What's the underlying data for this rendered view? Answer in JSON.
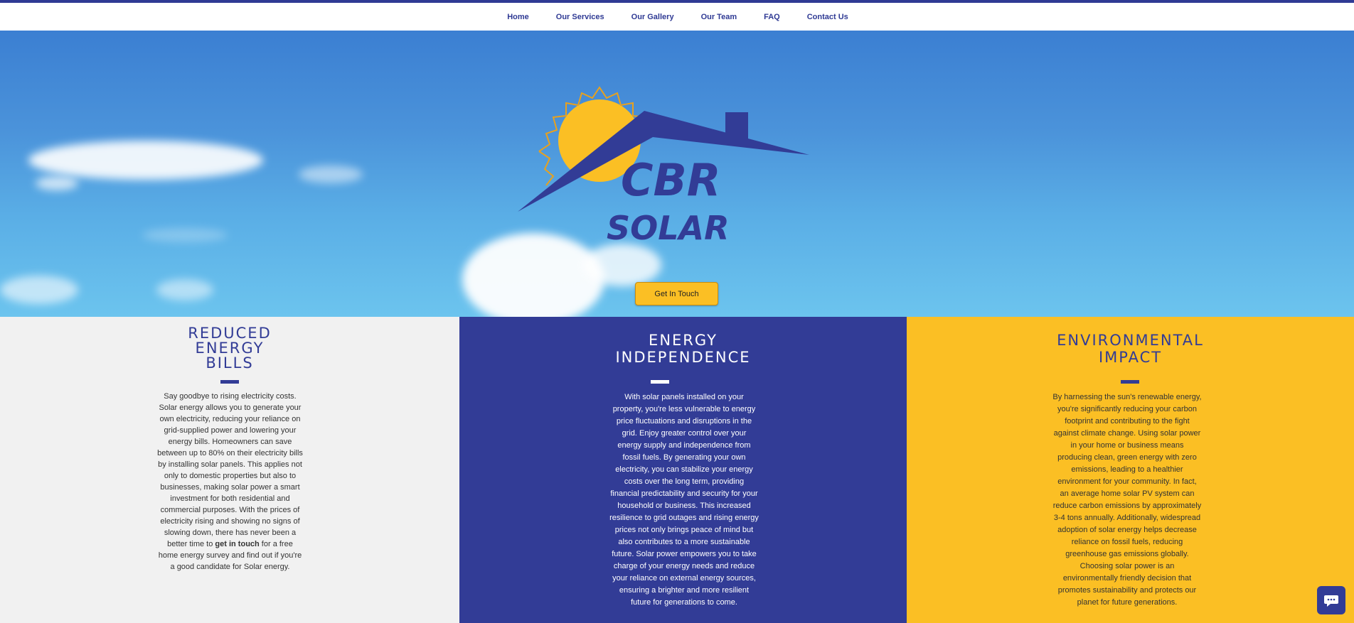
{
  "nav": {
    "items": [
      {
        "label": "Home"
      },
      {
        "label": "Our Services"
      },
      {
        "label": "Our Gallery"
      },
      {
        "label": "Our Team"
      },
      {
        "label": "FAQ"
      },
      {
        "label": "Contact Us"
      }
    ]
  },
  "hero": {
    "logo_line1": "CBR",
    "logo_line2": "SOLAR",
    "cta_label": "Get In Touch"
  },
  "sections": [
    {
      "title_lines": [
        "REDUCED",
        "ENERGY",
        "BILLS"
      ],
      "text_before": "Say goodbye to rising electricity costs. Solar energy allows you to generate your own electricity, reducing your reliance on grid-supplied power and lowering your energy bills. Homeowners can save between up to 80% on their electricity bills by installing solar panels. This applies not only to domestic properties but also to businesses, making solar power a smart investment for both residential and commercial purposes. With the prices of electricity rising and showing no signs of slowing down, there has never been a better time to ",
      "text_link": "get in touch",
      "text_after": " for a free home energy survey and find out if you're a good candidate for Solar energy."
    },
    {
      "title_lines": [
        "ENERGY",
        "INDEPENDENCE"
      ],
      "text": "With solar panels installed on your property, you're less vulnerable to energy price fluctuations and disruptions in the grid. Enjoy greater control over your energy supply and independence from fossil fuels. By generating your own electricity, you can stabilize your energy costs over the long term, providing financial predictability and security for your household or business. This increased resilience to grid outages and rising energy prices not only brings peace of mind but also contributes to a more sustainable future. Solar power empowers you to take charge of your energy needs and reduce your reliance on external energy sources, ensuring a brighter and more resilient future for generations to come."
    },
    {
      "title_lines": [
        "ENVIRONMENTAL",
        "IMPACT"
      ],
      "text": "By harnessing the sun's renewable energy, you're significantly reducing your carbon footprint and contributing to the fight against climate change. Using solar power in your home or business means producing clean, green energy with zero emissions, leading to a healthier environment for your community. In fact, an average home solar PV system can reduce carbon emissions by approximately 3-4 tons annually. Additionally, widespread adoption of solar energy helps decrease reliance on fossil fuels, reducing greenhouse gas emissions globally. Choosing solar power is an environmentally friendly decision that promotes sustainability and protects our planet for future generations."
    }
  ],
  "colors": {
    "brand_blue": "#323c96",
    "brand_yellow": "#fbbf24",
    "light_gray": "#f1f1f1"
  },
  "icons": {
    "chat": "chat-bubble-icon"
  }
}
